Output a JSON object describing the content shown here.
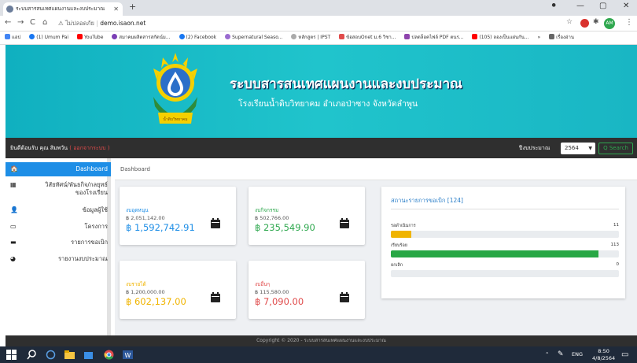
{
  "browser": {
    "tab_title": "ระบบสารสนเทศแผนงานและงบประมาณ",
    "tab_close": "✕",
    "new_tab": "+",
    "window_controls": [
      "⚫",
      "—",
      "▢",
      "✕"
    ],
    "nav_back": "←",
    "nav_forward": "→",
    "nav_reload": "C",
    "nav_home": "⌂",
    "not_secure": "ไม่ปลอดภัย",
    "url": "demo.isaon.net",
    "bookmarks": [
      "แอป",
      "(1) Umum Pai",
      "YouTube",
      "สมาคมผลิตสารสกัดน์ม...",
      "(2) Facebook",
      "Supernatural Seaso...",
      "หลักสูตร | IPST",
      "ข้อสอบOnet ม.6 วิชา...",
      "ปลดล็อคไฟล์ PDF ตนร...",
      "(105) ลองเป็นแผ่นกัน...",
      "»",
      "เรื่องอ่าน"
    ],
    "profile_initials": "AM"
  },
  "banner": {
    "title": "ระบบสารสนเทศแผนงานและงบประมาณ",
    "subtitle": "โรงเรียนน้ำดิบวิทยาคม อำเภอป่าซาง จังหวัดลำพูน",
    "seal_text": "น้ำดิบวิทยาคม"
  },
  "topnav": {
    "welcome": "ยินดีต้อนรับ คุณ สิมพวัน",
    "logout": "( ออกจากระบบ )",
    "year_label": "ปีงบประมาณ",
    "year_value": "2564",
    "search": "Q Search"
  },
  "sidebar": {
    "items": [
      {
        "label": "Dashboard",
        "icon": "home-icon",
        "glyph": "🏠"
      },
      {
        "label": "วิสัยทัศน์/พันธกิจ/กลยุทธ์ ของโรงเรียน",
        "icon": "list-icon",
        "glyph": "▦"
      },
      {
        "label": "ข้อมูลผู้ใช้",
        "icon": "user-icon",
        "glyph": "👤"
      },
      {
        "label": "โครงการ",
        "icon": "project-icon",
        "glyph": "▭"
      },
      {
        "label": "รายการขอเบิก",
        "icon": "wallet-icon",
        "glyph": "▬"
      },
      {
        "label": "รายงานงบประมาณ",
        "icon": "chart-pie-icon",
        "glyph": "◕"
      }
    ]
  },
  "breadcrumb": "Dashboard",
  "cards": [
    {
      "title": "งบอุดหนุน",
      "subtitle": "฿ 2,051,142.00",
      "value": "฿ 1,592,742.91",
      "title_color": "#1e8ee6",
      "value_color": "#1e8ee6"
    },
    {
      "title": "งบกิจกรรม",
      "subtitle": "฿ 502,766.00",
      "value": "฿ 235,549.90",
      "title_color": "#2fa84f",
      "value_color": "#2fa84f"
    },
    {
      "title": "งบรายได้",
      "subtitle": "฿ 1,200,000.00",
      "value": "฿ 602,137.00",
      "title_color": "#f0b400",
      "value_color": "#f0b400"
    },
    {
      "title": "งบอื่นๆ",
      "subtitle": "฿ 115,580.00",
      "value": "฿ 7,090.00",
      "title_color": "#e04b4b",
      "value_color": "#e04b4b"
    }
  ],
  "status": {
    "heading": "สถานะรายการขอเบิก [124]",
    "rows": [
      {
        "label": "รอดำเนินการ",
        "count": "11",
        "fraction": 0.089,
        "color": "#f0b400"
      },
      {
        "label": "เรียบร้อย",
        "count": "113",
        "fraction": 0.911,
        "color": "#28a745"
      },
      {
        "label": "ยกเลิก",
        "count": "0",
        "fraction": 0.0,
        "color": "#e04b4b"
      }
    ]
  },
  "footer": "Copyright © 2020 - ระบบสารสนเทศแผนงานและงบประมาณ",
  "taskbar": {
    "time": "8:50",
    "date": "4/8/2564",
    "lang": "ENG",
    "tray_up": "⌃"
  }
}
